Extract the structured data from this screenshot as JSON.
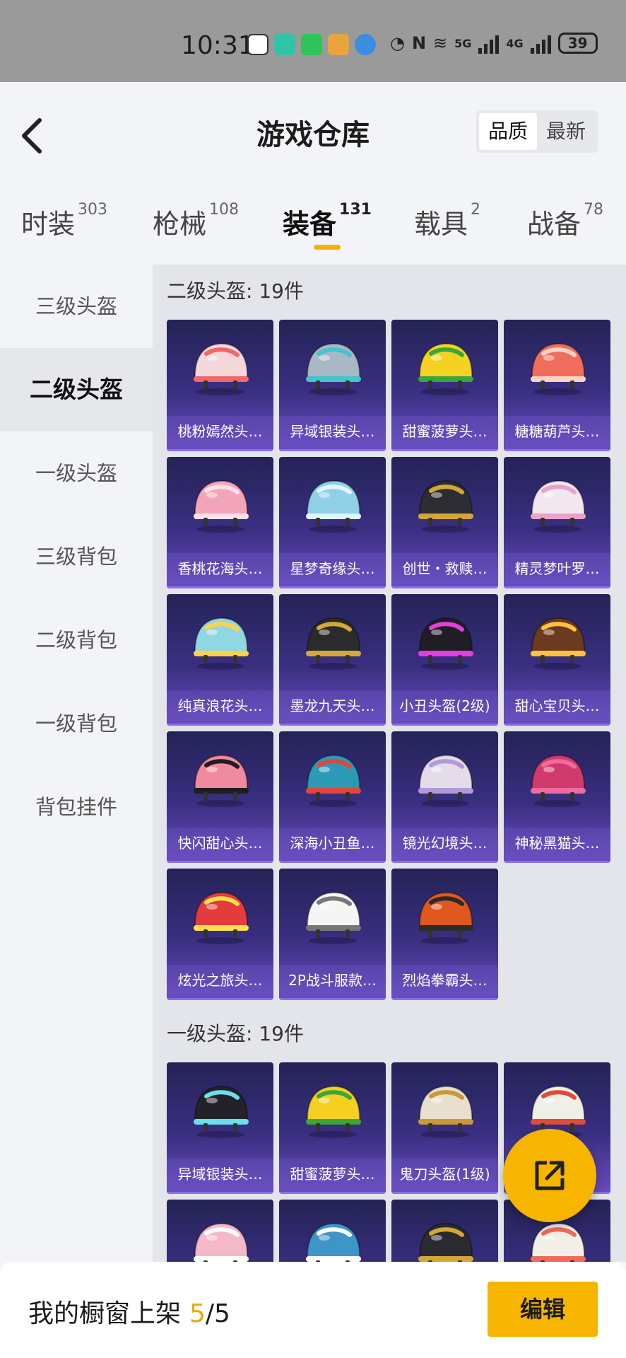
{
  "status_bar": {
    "time": "10:31",
    "battery": "39",
    "net1": "5G",
    "net2": "4G"
  },
  "header": {
    "back_icon": "chevron-left-icon",
    "title": "游戏仓库",
    "sort_options": [
      "品质",
      "最新"
    ],
    "sort_active": "品质"
  },
  "tabs": [
    {
      "label": "时装",
      "count": "303"
    },
    {
      "label": "枪械",
      "count": "108"
    },
    {
      "label": "装备",
      "count": "131"
    },
    {
      "label": "载具",
      "count": "2"
    },
    {
      "label": "战备",
      "count": "78"
    }
  ],
  "active_tab": "装备",
  "sidebar": {
    "items": [
      "三级头盔",
      "二级头盔",
      "一级头盔",
      "三级背包",
      "二级背包",
      "一级背包",
      "背包挂件"
    ],
    "active": "二级头盔"
  },
  "sections": [
    {
      "title": "二级头盔: 19件",
      "items": [
        {
          "name": "桃粉嫣然头…",
          "color": "#f3d7d9",
          "accent": "#f0686a"
        },
        {
          "name": "异域银装头…",
          "color": "#a9b8c5",
          "accent": "#46c4c9"
        },
        {
          "name": "甜蜜菠萝头…",
          "color": "#f5d222",
          "accent": "#3aa63b"
        },
        {
          "name": "糖糖葫芦头…",
          "color": "#f06d5c",
          "accent": "#ffd4c4"
        },
        {
          "name": "香桃花海头…",
          "color": "#f4a4b8",
          "accent": "#ffe0ea"
        },
        {
          "name": "星梦奇缘头…",
          "color": "#8fd0e6",
          "accent": "#e0f5ff"
        },
        {
          "name": "创世・救赎…",
          "color": "#2c2c32",
          "accent": "#d4a63a"
        },
        {
          "name": "精灵梦叶罗…",
          "color": "#f2e6ef",
          "accent": "#e9a3c8"
        },
        {
          "name": "纯真浪花头…",
          "color": "#8fd7e2",
          "accent": "#ffd24a"
        },
        {
          "name": "墨龙九天头…",
          "color": "#2b2b2b",
          "accent": "#d6a83a"
        },
        {
          "name": "小丑头盔(2级)",
          "color": "#1f1d25",
          "accent": "#e53ee0"
        },
        {
          "name": "甜心宝贝头…",
          "color": "#6b3a1f",
          "accent": "#ffc23c"
        },
        {
          "name": "快闪甜心头…",
          "color": "#f08aa0",
          "accent": "#1e1e1e"
        },
        {
          "name": "深海小丑鱼…",
          "color": "#2b9bb5",
          "accent": "#e2463a"
        },
        {
          "name": "镜光幻境头…",
          "color": "#e4dde9",
          "accent": "#b29ad8"
        },
        {
          "name": "神秘黑猫头…",
          "color": "#d13a6c",
          "accent": "#f06aa0"
        },
        {
          "name": "炫光之旅头…",
          "color": "#e43c3c",
          "accent": "#ffe24a"
        },
        {
          "name": "2P战斗服款…",
          "color": "#f5f5f5",
          "accent": "#777777"
        },
        {
          "name": "烈焰拳霸头…",
          "color": "#e0571f",
          "accent": "#2b2b2b"
        }
      ]
    },
    {
      "title": "一级头盔: 19件",
      "items": [
        {
          "name": "异域银装头…",
          "color": "#222228",
          "accent": "#6ae0ea"
        },
        {
          "name": "甜蜜菠萝头…",
          "color": "#f5d022",
          "accent": "#3aa63b"
        },
        {
          "name": "鬼刀头盔(1级)",
          "color": "#e8e0cc",
          "accent": "#c89a3a"
        },
        {
          "name": "",
          "color": "#f0efe6",
          "accent": "#e14a3a"
        },
        {
          "name": "",
          "color": "#f4b8c8",
          "accent": "#ffffff"
        },
        {
          "name": "",
          "color": "#3e96c8",
          "accent": "#ffffff"
        },
        {
          "name": "",
          "color": "#2a2a30",
          "accent": "#d4a63a"
        },
        {
          "name": "",
          "color": "#f2efe8",
          "accent": "#f06a5a"
        }
      ]
    }
  ],
  "bottom": {
    "showcase_label": "我的橱窗上架",
    "showcase_current": "5",
    "showcase_total": "/5",
    "edit_label": "编辑"
  },
  "fab_icon": "share-export-icon"
}
